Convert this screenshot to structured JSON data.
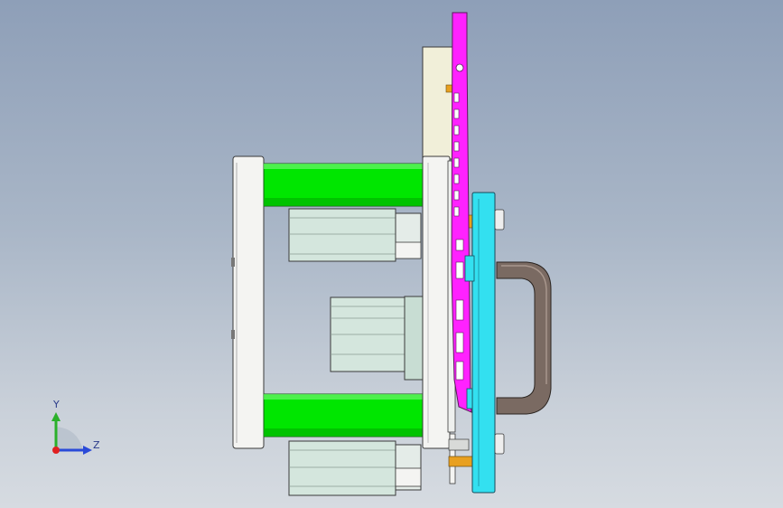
{
  "viewport": {
    "background_top": "#8e9fb8",
    "background_bottom": "#d6dbe1"
  },
  "parts": {
    "guide_pillar_color": "#00e600",
    "ejector_plate_color": "#ff22ff",
    "cavity_plate_color": "#33e0f0",
    "handle_color": "#7a6a62",
    "plate_color": "#f4f4f2",
    "block_color": "#d4e6dd",
    "pin_color": "#e8a020"
  },
  "triad": {
    "y_label": "Y",
    "z_label": "Z",
    "y_axis_color": "#2ab02a",
    "z_axis_color": "#2a4ad8",
    "x_axis_color": "#e02020",
    "origin_icon": "axis-triad-icon"
  }
}
